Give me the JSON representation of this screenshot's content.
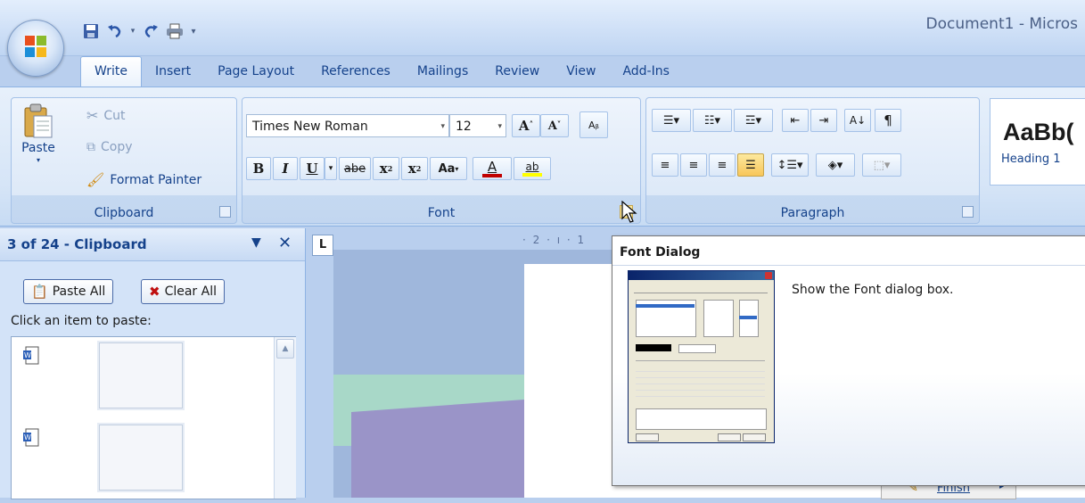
{
  "window": {
    "title": "Document1 - Micros"
  },
  "quick_access": {
    "buttons": [
      "save-icon",
      "undo-icon",
      "redo-icon",
      "print-icon",
      "customize-icon"
    ]
  },
  "tabs": [
    {
      "label": "Write",
      "active": true
    },
    {
      "label": "Insert"
    },
    {
      "label": "Page Layout"
    },
    {
      "label": "References"
    },
    {
      "label": "Mailings"
    },
    {
      "label": "Review"
    },
    {
      "label": "View"
    },
    {
      "label": "Add-Ins"
    }
  ],
  "ribbon": {
    "clipboard": {
      "label": "Clipboard",
      "paste_label": "Paste",
      "cut_label": "Cut",
      "copy_label": "Copy",
      "format_painter_label": "Format Painter"
    },
    "font": {
      "label": "Font",
      "font_name": "Times New Roman",
      "font_size": "12",
      "bold": "B",
      "italic": "I",
      "underline": "U",
      "strikethrough": "abe",
      "subscript": "x",
      "superscript": "x",
      "change_case": "Aa",
      "font_color": "A",
      "highlight": "ab"
    },
    "paragraph": {
      "label": "Paragraph",
      "pilcrow": "¶"
    },
    "styles": {
      "sample": "AaBb(",
      "name": "Heading 1"
    }
  },
  "task_pane": {
    "title": "3 of 24 - Clipboard",
    "paste_all_label": "Paste All",
    "clear_all_label": "Clear All",
    "hint": "Click an item to paste:"
  },
  "ruler": {
    "text": "· 2 · ı · 1"
  },
  "tooltip": {
    "title": "Font Dialog",
    "description": "Show the Font dialog box."
  },
  "document": {
    "finish_label": "Finish"
  },
  "colors": {
    "ribbon_text": "#15428b",
    "highlight_active": "#f8c65a",
    "font_color_bar": "#c00000",
    "highlight_bar": "#ffff00"
  }
}
